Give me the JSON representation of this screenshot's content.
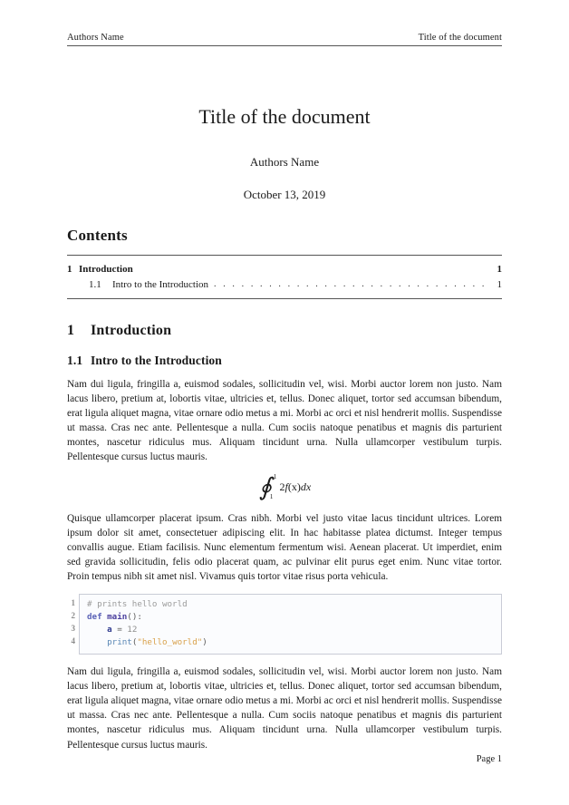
{
  "header": {
    "left": "Authors Name",
    "right": "Title of the document"
  },
  "title_block": {
    "title": "Title of the document",
    "author": "Authors Name",
    "date": "October 13, 2019"
  },
  "contents": {
    "heading": "Contents",
    "entries": [
      {
        "number": "1",
        "label": "Introduction",
        "page": "1",
        "leader": "",
        "level": 1
      },
      {
        "number": "1.1",
        "label": "Intro to the Introduction",
        "page": "1",
        "leader": ". . . . . . . . . . . . . . . . . . . . . . . . . . . . . . . . . . . . . . . . . . . . . . . . . . . . . . . . . . . . . . . . . . . . . .",
        "level": 2
      }
    ]
  },
  "section": {
    "number": "1",
    "title": "Introduction"
  },
  "subsection": {
    "number": "1.1",
    "title": "Intro to the Introduction"
  },
  "paragraphs": {
    "p1": "Nam dui ligula, fringilla a, euismod sodales, sollicitudin vel, wisi. Morbi auctor lorem non justo. Nam lacus libero, pretium at, lobortis vitae, ultricies et, tellus. Donec aliquet, tortor sed accumsan bibendum, erat ligula aliquet magna, vitae ornare odio metus a mi. Morbi ac orci et nisl hendrerit mollis. Suspendisse ut massa. Cras nec ante. Pellentesque a nulla. Cum sociis natoque penatibus et magnis dis parturient montes, nascetur ridiculus mus. Aliquam tincidunt urna. Nulla ullamcorper vestibulum turpis. Pellentesque cursus luctus mauris.",
    "p2": "Quisque ullamcorper placerat ipsum. Cras nibh. Morbi vel justo vitae lacus tincidunt ultrices. Lorem ipsum dolor sit amet, consectetuer adipiscing elit. In hac habitasse platea dictumst. Integer tempus convallis augue. Etiam facilisis. Nunc elementum fermentum wisi. Aenean placerat. Ut imperdiet, enim sed gravida sollicitudin, felis odio placerat quam, ac pulvinar elit purus eget enim. Nunc vitae tortor. Proin tempus nibh sit amet nisl. Vivamus quis tortor vitae risus porta vehicula.",
    "p3": "Nam dui ligula, fringilla a, euismod sodales, sollicitudin vel, wisi. Morbi auctor lorem non justo. Nam lacus libero, pretium at, lobortis vitae, ultricies et, tellus. Donec aliquet, tortor sed accumsan bibendum, erat ligula aliquet magna, vitae ornare odio metus a mi. Morbi ac orci et nisl hendrerit mollis. Suspendisse ut massa. Cras nec ante. Pellentesque a nulla. Cum sociis natoque penatibus et magnis dis parturient montes, nascetur ridiculus mus. Aliquam tincidunt urna. Nulla ullamcorper vestibulum turpis. Pellentesque cursus luctus mauris."
  },
  "equation": {
    "symbol": "∮",
    "upper_limit": "1",
    "lower_limit": "1",
    "coefficient": "2",
    "function": "f",
    "argument": "(x)",
    "differential": "dx"
  },
  "code_listing": {
    "language": "python",
    "line_numbers": [
      "1",
      "2",
      "3",
      "4"
    ],
    "lines": [
      {
        "comment": "# prints hello world"
      },
      {
        "kw": "def ",
        "fname": "main",
        "punct": "():"
      },
      {
        "indent": "    ",
        "var": "a",
        "op": " = ",
        "num": "12"
      },
      {
        "indent": "    ",
        "builtin": "print",
        "open": "(",
        "str": "\"hello_world\"",
        "close": ")"
      }
    ],
    "colors": {
      "comment": "#9b9b9b",
      "keyword": "#5b63b7",
      "function_name": "#4b3f9e",
      "variable": "#2f3b8f",
      "number": "#8d8d8d",
      "builtin": "#5a87b5",
      "string": "#d9a14b",
      "border": "#c9ccd6",
      "background": "#fbfcfe"
    }
  },
  "footer": {
    "page_label": "Page 1"
  }
}
